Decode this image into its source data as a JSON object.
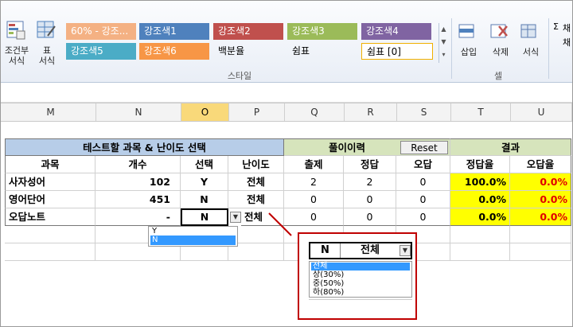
{
  "ribbon": {
    "cond_format_label": "조건부\n서식",
    "table_format_label": "표\n서식",
    "styles_group_label": "스타일",
    "cells_group_label": "셀",
    "cell_styles": [
      {
        "label": "60% - 강조...",
        "bg": "#f4b183",
        "fg": "#ffffff"
      },
      {
        "label": "강조색1",
        "bg": "#4f81bd",
        "fg": "#ffffff"
      },
      {
        "label": "강조색2",
        "bg": "#c0504d",
        "fg": "#ffffff"
      },
      {
        "label": "강조색3",
        "bg": "#9bbb59",
        "fg": "#ffffff"
      },
      {
        "label": "강조색4",
        "bg": "#8064a2",
        "fg": "#ffffff"
      },
      {
        "label": "강조색5",
        "bg": "#4bacc6",
        "fg": "#ffffff"
      },
      {
        "label": "강조색6",
        "bg": "#f79646",
        "fg": "#ffffff"
      },
      {
        "label": "백분율",
        "bg": "transparent",
        "fg": "#000000"
      },
      {
        "label": "쉼표",
        "bg": "transparent",
        "fg": "#000000"
      },
      {
        "label": "쉼표 [0]",
        "bg": "#ffffff",
        "fg": "#000000"
      }
    ],
    "insert_label": "삽입",
    "delete_label": "삭제",
    "format_label": "서식",
    "extra_labels": [
      "Σ",
      "채",
      "채"
    ]
  },
  "columns": [
    "M",
    "N",
    "O",
    "P",
    "Q",
    "R",
    "S",
    "T",
    "U"
  ],
  "selected_column": "O",
  "table": {
    "title_left": "테스트할 과목 & 난이도 선택",
    "title_mid": "풀이이력",
    "reset_button": "Reset",
    "title_right": "결과",
    "headers": [
      "과목",
      "개수",
      "선택",
      "난이도",
      "출제",
      "정답",
      "오답",
      "정답율",
      "오답율"
    ],
    "rows": [
      {
        "subject": "사자성어",
        "count": "102",
        "select": "Y",
        "level": "전체",
        "asked": "2",
        "correct": "2",
        "wrong": "0",
        "correct_rate": "100.0%",
        "wrong_rate": "0.0%"
      },
      {
        "subject": "영어단어",
        "count": "451",
        "select": "N",
        "level": "전체",
        "asked": "0",
        "correct": "0",
        "wrong": "0",
        "correct_rate": "0.0%",
        "wrong_rate": "0.0%"
      },
      {
        "subject": "오답노트",
        "count": "-",
        "select": "N",
        "level": "전체",
        "asked": "0",
        "correct": "0",
        "wrong": "0",
        "correct_rate": "0.0%",
        "wrong_rate": "0.0%"
      }
    ]
  },
  "select_dropdown": {
    "options": [
      "Y",
      "N"
    ],
    "highlighted": "N"
  },
  "zoom_popup": {
    "select_value": "N",
    "level_value": "전체",
    "options": [
      "전체",
      "상(30%)",
      "중(50%)",
      "하(80%)"
    ],
    "highlighted": "전체"
  },
  "colors": {
    "accent_red": "#c00000",
    "dropdown_highlight": "#3399ff"
  }
}
